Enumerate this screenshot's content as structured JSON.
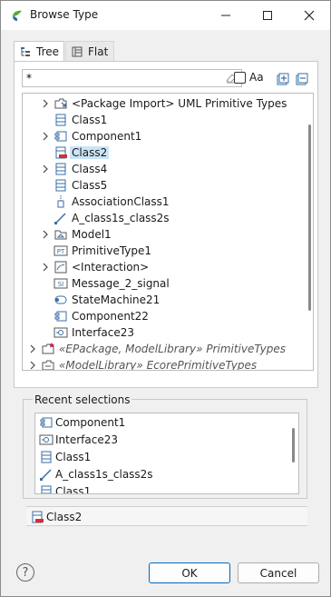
{
  "window": {
    "title": "Browse Type"
  },
  "tabs": [
    {
      "label": "Tree",
      "icon": "tree-view-icon",
      "selected": true
    },
    {
      "label": "Flat",
      "icon": "flat-list-icon",
      "selected": false
    }
  ],
  "filter": {
    "value": "*",
    "case_label": "Aa",
    "case_checked": false
  },
  "tree": {
    "items": [
      {
        "label": "<Package Import> UML Primitive Types",
        "icon": "package-import-icon",
        "expandable": true,
        "muted": false,
        "selected": false
      },
      {
        "label": "Class1",
        "icon": "class-icon",
        "expandable": false,
        "muted": false,
        "selected": false
      },
      {
        "label": "Component1",
        "icon": "component-icon",
        "expandable": true,
        "muted": false,
        "selected": false
      },
      {
        "label": "Class2",
        "icon": "class-error-icon",
        "expandable": false,
        "muted": false,
        "selected": true
      },
      {
        "label": "Class4",
        "icon": "class-icon",
        "expandable": true,
        "muted": false,
        "selected": false
      },
      {
        "label": "Class5",
        "icon": "class-icon",
        "expandable": false,
        "muted": false,
        "selected": false
      },
      {
        "label": "AssociationClass1",
        "icon": "association-class-icon",
        "expandable": false,
        "muted": false,
        "selected": false
      },
      {
        "label": "A_class1s_class2s",
        "icon": "association-icon",
        "expandable": false,
        "muted": false,
        "selected": false
      },
      {
        "label": "Model1",
        "icon": "model-icon",
        "expandable": true,
        "muted": false,
        "selected": false
      },
      {
        "label": "PrimitiveType1",
        "icon": "primitive-type-icon",
        "expandable": false,
        "muted": false,
        "selected": false
      },
      {
        "label": "<Interaction>",
        "icon": "interaction-icon",
        "expandable": true,
        "muted": false,
        "selected": false
      },
      {
        "label": "Message_2_signal",
        "icon": "signal-icon",
        "expandable": false,
        "muted": false,
        "selected": false
      },
      {
        "label": "StateMachine21",
        "icon": "state-machine-icon",
        "expandable": false,
        "muted": false,
        "selected": false
      },
      {
        "label": "Component22",
        "icon": "component-icon",
        "expandable": false,
        "muted": false,
        "selected": false
      },
      {
        "label": "Interface23",
        "icon": "interface-icon",
        "expandable": false,
        "muted": false,
        "selected": false
      },
      {
        "label": "«EPackage, ModelLibrary» PrimitiveTypes",
        "icon": "epackage-icon",
        "expandable": true,
        "muted": true,
        "selected": false
      },
      {
        "label": "«ModelLibrary» EcorePrimitiveTypes",
        "icon": "model-library-icon",
        "expandable": true,
        "muted": true,
        "selected": false
      }
    ]
  },
  "recent": {
    "title": "Recent selections",
    "items": [
      {
        "label": "Component1",
        "icon": "component-icon"
      },
      {
        "label": "Interface23",
        "icon": "interface-icon"
      },
      {
        "label": "Class1",
        "icon": "class-icon"
      },
      {
        "label": "A_class1s_class2s",
        "icon": "association-icon"
      },
      {
        "label": "Class1",
        "icon": "class-icon"
      }
    ]
  },
  "selection": {
    "label": "Class2",
    "icon": "class-error-icon"
  },
  "buttons": {
    "help": "?",
    "ok": "OK",
    "cancel": "Cancel"
  },
  "colors": {
    "accent": "#0067c0",
    "selection_bg": "#cce4f7",
    "error_red": "#d32f2f",
    "icon_blue": "#3a6ea5"
  }
}
